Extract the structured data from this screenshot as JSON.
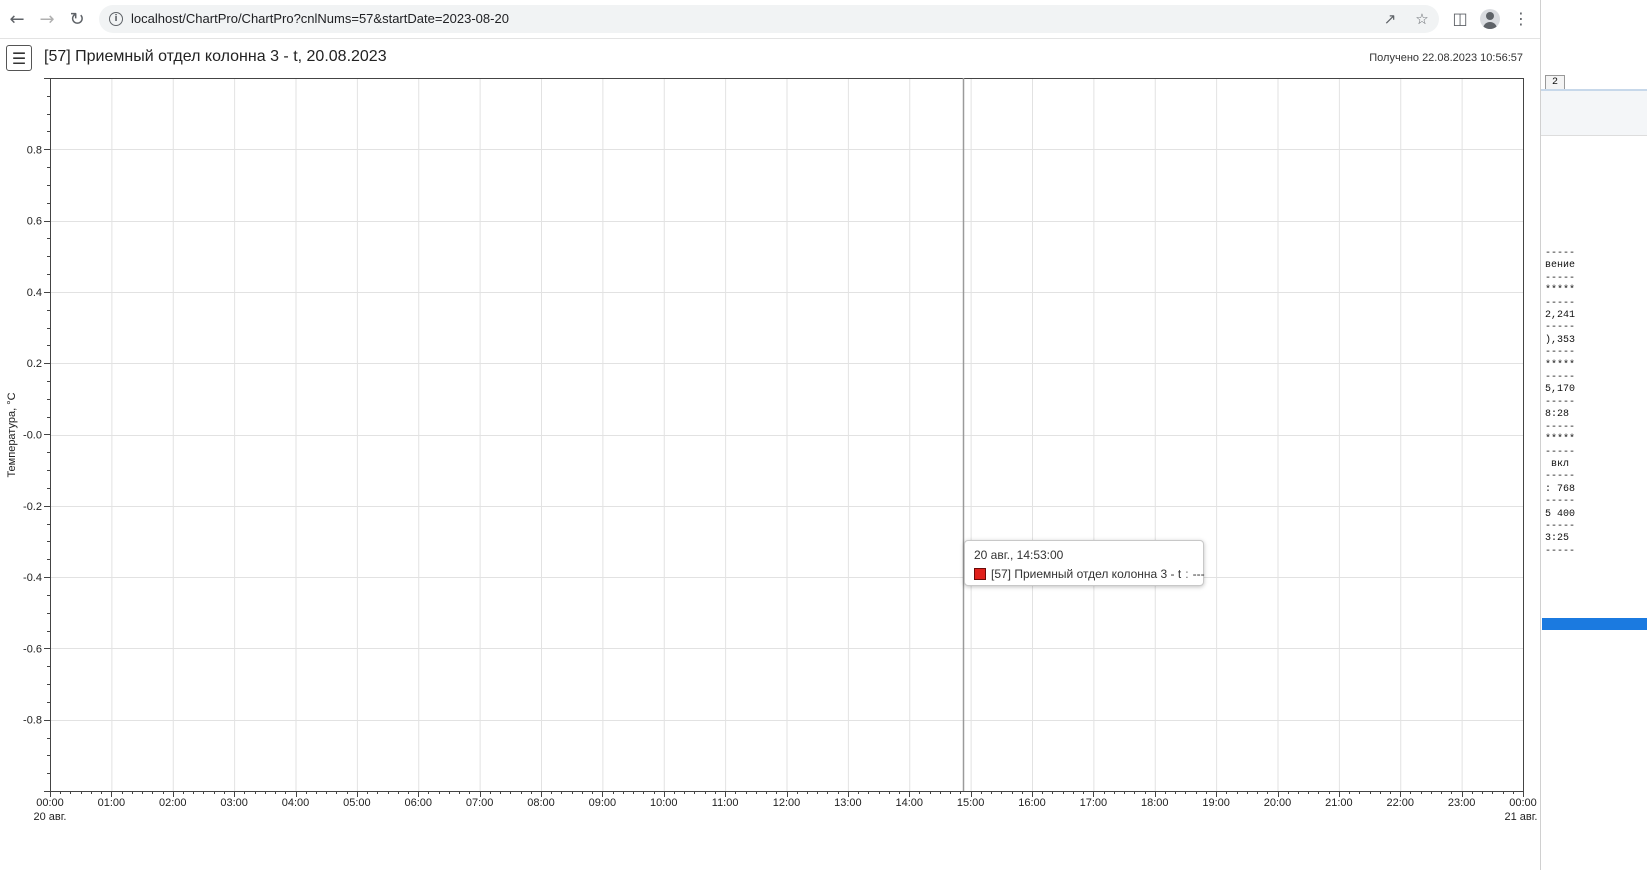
{
  "browser": {
    "back_icon": "arrow-left-icon",
    "forward_icon": "arrow-right-icon",
    "reload_icon": "reload-icon",
    "url": "localhost/ChartPro/ChartPro?cnlNums=57&startDate=2023-08-20",
    "share_icon": "share-icon",
    "star_icon": "star-icon",
    "sidepanel_icon": "side-panel-icon",
    "profile_icon": "avatar-icon",
    "menu_icon": "kebab-menu-icon"
  },
  "header": {
    "menu_icon": "hamburger-icon",
    "title": "[57] Приемный отдел колонна 3 - t, 20.08.2023",
    "received": "Получено 22.08.2023 10:56:57"
  },
  "chart_data": {
    "type": "line",
    "ylabel": "Температура, °C",
    "y_ticks": [
      "0.8",
      "0.6",
      "0.4",
      "0.2",
      "-0.0",
      "-0.2",
      "-0.4",
      "-0.6",
      "-0.8"
    ],
    "y_tick_values": [
      0.8,
      0.6,
      0.4,
      0.2,
      0.0,
      -0.2,
      -0.4,
      -0.6,
      -0.8
    ],
    "ylim": [
      -1.0,
      1.0
    ],
    "x_ticks": [
      "00:00",
      "01:00",
      "02:00",
      "03:00",
      "04:00",
      "05:00",
      "06:00",
      "07:00",
      "08:00",
      "09:00",
      "10:00",
      "11:00",
      "12:00",
      "13:00",
      "14:00",
      "15:00",
      "16:00",
      "17:00",
      "18:00",
      "19:00",
      "20:00",
      "21:00",
      "22:00",
      "23:00",
      "00:00"
    ],
    "x_hours": [
      0,
      1,
      2,
      3,
      4,
      5,
      6,
      7,
      8,
      9,
      10,
      11,
      12,
      13,
      14,
      15,
      16,
      17,
      18,
      19,
      20,
      21,
      22,
      23,
      24
    ],
    "x_date_start": "20 авг.",
    "x_date_end": "21 авг.",
    "xlim_hours": [
      0,
      24
    ],
    "grid": true,
    "series": [
      {
        "name": "[57] Приемный отдел колонна 3 - t",
        "color": "#e0201b",
        "values": []
      }
    ],
    "cursor_hour": 14.883
  },
  "tooltip": {
    "time": "20 авг., 14:53:00",
    "series_label": "[57] Приемный отдел колонна 3 - t",
    "separator": ":",
    "value": "---"
  },
  "side_panel": {
    "tab_label": "2",
    "lines": "-----\nвение\n-----\n*****\n-----\n2,241\n-----\n),353\n-----\n*****\n-----\n5,170\n-----\n8:28\n-----\n*****\n-----\n вкл\n-----\n: 768\n-----\n5 400\n-----\n3:25\n-----"
  }
}
